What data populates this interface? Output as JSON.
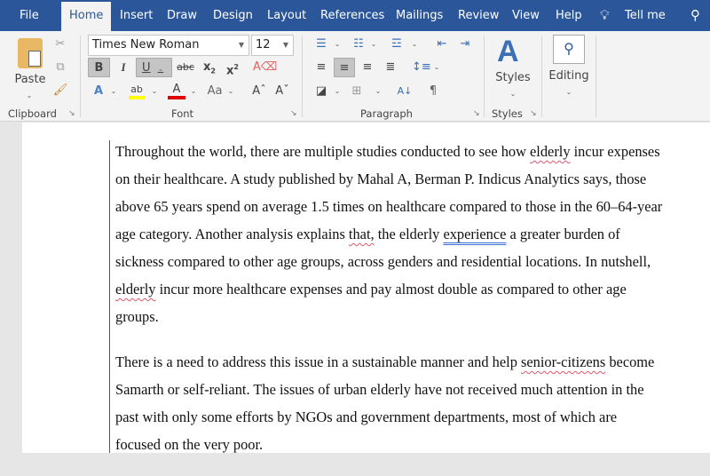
{
  "tabs": [
    "File",
    "Home",
    "Insert",
    "Draw",
    "Design",
    "Layout",
    "References",
    "Mailings",
    "Review",
    "View",
    "Help"
  ],
  "tell_me": "Tell me",
  "clipboard": {
    "paste": "Paste",
    "label": "Clipboard"
  },
  "font": {
    "name": "Times New Roman",
    "size": "12",
    "label": "Font",
    "bold": "B",
    "italic": "I",
    "underline": "U",
    "strike": "abc",
    "change_case": "Aa",
    "highlight_color": "#ffff00",
    "font_color": "#e00000"
  },
  "paragraph": {
    "label": "Paragraph",
    "pilcrow": "¶"
  },
  "styles": {
    "label": "Styles",
    "group_label": "Styles"
  },
  "editing": {
    "label": "Editing"
  },
  "document": {
    "paragraphs": [
      [
        [
          {
            "t": "Throughout the world, there are multiple studies conducted to see how "
          },
          {
            "t": "elderly",
            "m": "spell"
          },
          {
            "t": " incur expenses"
          }
        ],
        [
          {
            "t": "on their healthcare. A study published by Mahal A, Berman P. Indicus Analytics says, those"
          }
        ],
        [
          {
            "t": "above 65 years spend on average 1.5 times on healthcare compared to those in the 60–64-year"
          }
        ],
        [
          {
            "t": "age category. Another analysis explains "
          },
          {
            "t": "that,",
            "m": "spell"
          },
          {
            "t": " the elderly "
          },
          {
            "t": "experience",
            "m": "gram"
          },
          {
            "t": " a greater burden of"
          }
        ],
        [
          {
            "t": "sickness compared to other age groups, across genders and residential locations. In nutshell,"
          }
        ],
        [
          {
            "t": "elderly",
            "m": "spell"
          },
          {
            "t": " incur more healthcare expenses and pay almost double as compared to other age"
          }
        ],
        [
          {
            "t": "groups."
          }
        ]
      ],
      [
        [
          {
            "t": "There is a need to address this issue in a sustainable manner and help "
          },
          {
            "t": "senior-citizens",
            "m": "spell"
          },
          {
            "t": " become"
          }
        ],
        [
          {
            "t": "Samarth or self-reliant. The issues of urban elderly have not received much attention in the"
          }
        ],
        [
          {
            "t": "past with only some efforts by NGOs and government departments, most of which are"
          }
        ],
        [
          {
            "t": "focused on the very poor."
          }
        ]
      ]
    ]
  }
}
